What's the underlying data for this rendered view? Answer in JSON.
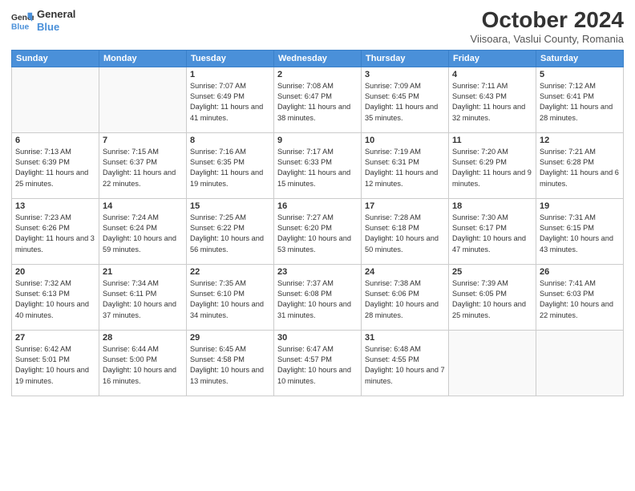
{
  "header": {
    "logo_line1": "General",
    "logo_line2": "Blue",
    "month": "October 2024",
    "location": "Viisoara, Vaslui County, Romania"
  },
  "days_of_week": [
    "Sunday",
    "Monday",
    "Tuesday",
    "Wednesday",
    "Thursday",
    "Friday",
    "Saturday"
  ],
  "weeks": [
    [
      {
        "day": "",
        "info": ""
      },
      {
        "day": "",
        "info": ""
      },
      {
        "day": "1",
        "info": "Sunrise: 7:07 AM\nSunset: 6:49 PM\nDaylight: 11 hours and 41 minutes."
      },
      {
        "day": "2",
        "info": "Sunrise: 7:08 AM\nSunset: 6:47 PM\nDaylight: 11 hours and 38 minutes."
      },
      {
        "day": "3",
        "info": "Sunrise: 7:09 AM\nSunset: 6:45 PM\nDaylight: 11 hours and 35 minutes."
      },
      {
        "day": "4",
        "info": "Sunrise: 7:11 AM\nSunset: 6:43 PM\nDaylight: 11 hours and 32 minutes."
      },
      {
        "day": "5",
        "info": "Sunrise: 7:12 AM\nSunset: 6:41 PM\nDaylight: 11 hours and 28 minutes."
      }
    ],
    [
      {
        "day": "6",
        "info": "Sunrise: 7:13 AM\nSunset: 6:39 PM\nDaylight: 11 hours and 25 minutes."
      },
      {
        "day": "7",
        "info": "Sunrise: 7:15 AM\nSunset: 6:37 PM\nDaylight: 11 hours and 22 minutes."
      },
      {
        "day": "8",
        "info": "Sunrise: 7:16 AM\nSunset: 6:35 PM\nDaylight: 11 hours and 19 minutes."
      },
      {
        "day": "9",
        "info": "Sunrise: 7:17 AM\nSunset: 6:33 PM\nDaylight: 11 hours and 15 minutes."
      },
      {
        "day": "10",
        "info": "Sunrise: 7:19 AM\nSunset: 6:31 PM\nDaylight: 11 hours and 12 minutes."
      },
      {
        "day": "11",
        "info": "Sunrise: 7:20 AM\nSunset: 6:29 PM\nDaylight: 11 hours and 9 minutes."
      },
      {
        "day": "12",
        "info": "Sunrise: 7:21 AM\nSunset: 6:28 PM\nDaylight: 11 hours and 6 minutes."
      }
    ],
    [
      {
        "day": "13",
        "info": "Sunrise: 7:23 AM\nSunset: 6:26 PM\nDaylight: 11 hours and 3 minutes."
      },
      {
        "day": "14",
        "info": "Sunrise: 7:24 AM\nSunset: 6:24 PM\nDaylight: 10 hours and 59 minutes."
      },
      {
        "day": "15",
        "info": "Sunrise: 7:25 AM\nSunset: 6:22 PM\nDaylight: 10 hours and 56 minutes."
      },
      {
        "day": "16",
        "info": "Sunrise: 7:27 AM\nSunset: 6:20 PM\nDaylight: 10 hours and 53 minutes."
      },
      {
        "day": "17",
        "info": "Sunrise: 7:28 AM\nSunset: 6:18 PM\nDaylight: 10 hours and 50 minutes."
      },
      {
        "day": "18",
        "info": "Sunrise: 7:30 AM\nSunset: 6:17 PM\nDaylight: 10 hours and 47 minutes."
      },
      {
        "day": "19",
        "info": "Sunrise: 7:31 AM\nSunset: 6:15 PM\nDaylight: 10 hours and 43 minutes."
      }
    ],
    [
      {
        "day": "20",
        "info": "Sunrise: 7:32 AM\nSunset: 6:13 PM\nDaylight: 10 hours and 40 minutes."
      },
      {
        "day": "21",
        "info": "Sunrise: 7:34 AM\nSunset: 6:11 PM\nDaylight: 10 hours and 37 minutes."
      },
      {
        "day": "22",
        "info": "Sunrise: 7:35 AM\nSunset: 6:10 PM\nDaylight: 10 hours and 34 minutes."
      },
      {
        "day": "23",
        "info": "Sunrise: 7:37 AM\nSunset: 6:08 PM\nDaylight: 10 hours and 31 minutes."
      },
      {
        "day": "24",
        "info": "Sunrise: 7:38 AM\nSunset: 6:06 PM\nDaylight: 10 hours and 28 minutes."
      },
      {
        "day": "25",
        "info": "Sunrise: 7:39 AM\nSunset: 6:05 PM\nDaylight: 10 hours and 25 minutes."
      },
      {
        "day": "26",
        "info": "Sunrise: 7:41 AM\nSunset: 6:03 PM\nDaylight: 10 hours and 22 minutes."
      }
    ],
    [
      {
        "day": "27",
        "info": "Sunrise: 6:42 AM\nSunset: 5:01 PM\nDaylight: 10 hours and 19 minutes."
      },
      {
        "day": "28",
        "info": "Sunrise: 6:44 AM\nSunset: 5:00 PM\nDaylight: 10 hours and 16 minutes."
      },
      {
        "day": "29",
        "info": "Sunrise: 6:45 AM\nSunset: 4:58 PM\nDaylight: 10 hours and 13 minutes."
      },
      {
        "day": "30",
        "info": "Sunrise: 6:47 AM\nSunset: 4:57 PM\nDaylight: 10 hours and 10 minutes."
      },
      {
        "day": "31",
        "info": "Sunrise: 6:48 AM\nSunset: 4:55 PM\nDaylight: 10 hours and 7 minutes."
      },
      {
        "day": "",
        "info": ""
      },
      {
        "day": "",
        "info": ""
      }
    ]
  ]
}
